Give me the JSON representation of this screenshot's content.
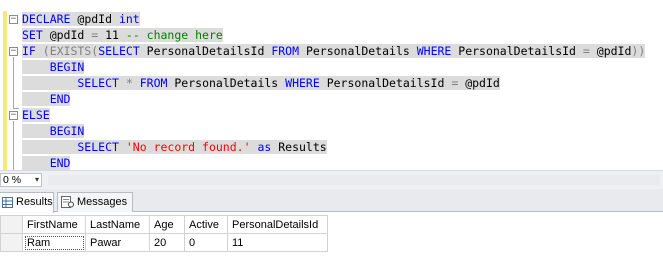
{
  "editor": {
    "lines": [
      [
        {
          "t": "DECLARE",
          "c": "kw"
        },
        {
          "t": " @pdId ",
          "c": "pl"
        },
        {
          "t": "int",
          "c": "kw"
        }
      ],
      [
        {
          "t": "SET",
          "c": "kw"
        },
        {
          "t": " @pdId ",
          "c": "pl"
        },
        {
          "t": "=",
          "c": "gr"
        },
        {
          "t": " 11 ",
          "c": "pl"
        },
        {
          "t": "-- change here",
          "c": "cm"
        }
      ],
      [
        {
          "t": "IF",
          "c": "kw"
        },
        {
          "t": " (",
          "c": "gr"
        },
        {
          "t": "EXISTS",
          "c": "gr"
        },
        {
          "t": "(",
          "c": "gr"
        },
        {
          "t": "SELECT",
          "c": "kw"
        },
        {
          "t": " PersonalDetailsId ",
          "c": "pl"
        },
        {
          "t": "FROM",
          "c": "kw"
        },
        {
          "t": " PersonalDetails ",
          "c": "pl"
        },
        {
          "t": "WHERE",
          "c": "kw"
        },
        {
          "t": " PersonalDetailsId ",
          "c": "pl"
        },
        {
          "t": "=",
          "c": "gr"
        },
        {
          "t": " @pdId",
          "c": "pl"
        },
        {
          "t": "))",
          "c": "gr"
        }
      ],
      [
        {
          "t": "    BEGIN",
          "c": "kw"
        }
      ],
      [
        {
          "t": "        SELECT",
          "c": "kw"
        },
        {
          "t": " ",
          "c": "pl"
        },
        {
          "t": "*",
          "c": "gr"
        },
        {
          "t": " ",
          "c": "pl"
        },
        {
          "t": "FROM",
          "c": "kw"
        },
        {
          "t": " PersonalDetails ",
          "c": "pl"
        },
        {
          "t": "WHERE",
          "c": "kw"
        },
        {
          "t": " PersonalDetailsId ",
          "c": "pl"
        },
        {
          "t": "=",
          "c": "gr"
        },
        {
          "t": " @pdId",
          "c": "pl"
        }
      ],
      [
        {
          "t": "    END",
          "c": "kw"
        }
      ],
      [
        {
          "t": "ELSE",
          "c": "kw"
        }
      ],
      [
        {
          "t": "    BEGIN",
          "c": "kw"
        }
      ],
      [
        {
          "t": "        SELECT",
          "c": "kw"
        },
        {
          "t": " ",
          "c": "pl"
        },
        {
          "t": "'No record found.'",
          "c": "st"
        },
        {
          "t": " ",
          "c": "pl"
        },
        {
          "t": "as",
          "c": "kw"
        },
        {
          "t": " Results",
          "c": "pl"
        }
      ],
      [
        {
          "t": "    END",
          "c": "kw"
        }
      ]
    ],
    "fold_markers": [
      "−",
      "−",
      "−"
    ]
  },
  "zoom": {
    "value": "0 %",
    "arrow": "▾"
  },
  "tabs": [
    {
      "label": "Results",
      "icon": "results-grid-icon",
      "active": true
    },
    {
      "label": "Messages",
      "icon": "messages-icon",
      "active": false
    }
  ],
  "grid": {
    "columns": [
      "FirstName",
      "LastName",
      "Age",
      "Active",
      "PersonalDetailsId"
    ],
    "rows": [
      [
        "Ram",
        "Pawar",
        "20",
        "0",
        "11"
      ]
    ],
    "row_numbers": [
      ""
    ]
  },
  "colors": {
    "keyword": "#0000ff",
    "operator": "#808080",
    "comment": "#008000",
    "string": "#ff0000",
    "change_bar": "#f3ea7a",
    "highlight": "#dcdcdc"
  }
}
